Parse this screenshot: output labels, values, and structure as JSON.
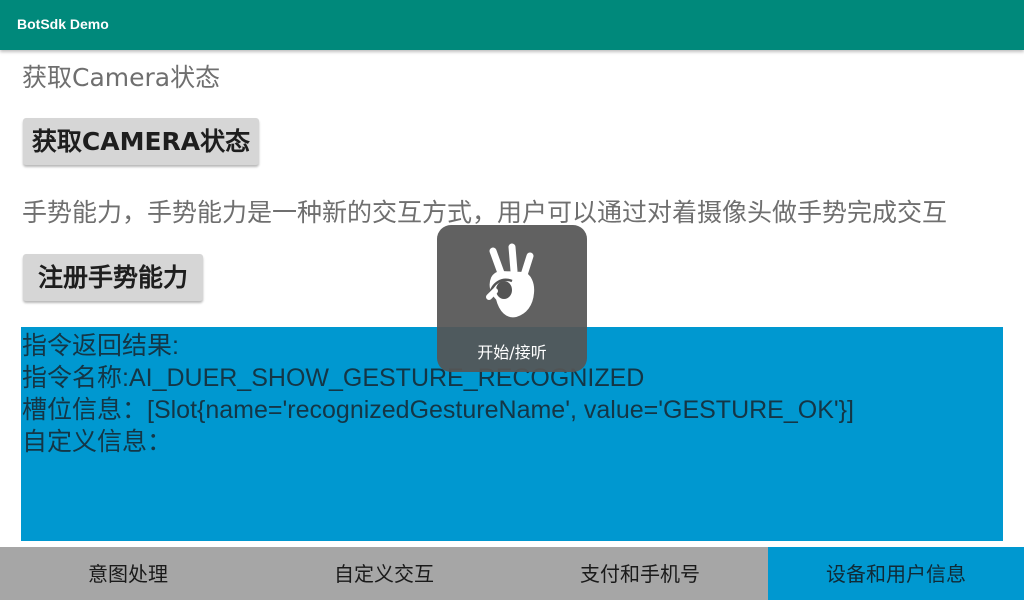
{
  "appbar": {
    "title": "BotSdk Demo"
  },
  "camera": {
    "status_label": "获取Camera状态",
    "button_label": "获取CAMERA状态"
  },
  "gesture": {
    "description": "手势能力，手势能力是一种新的交互方式，用户可以通过对着摄像头做手势完成交互",
    "register_button_label": "注册手势能力"
  },
  "result": {
    "lines": [
      "指令返回结果:",
      "指令名称:AI_DUER_SHOW_GESTURE_RECOGNIZED",
      "槽位信息：[Slot{name='recognizedGestureName', value='GESTURE_OK'}]",
      "自定义信息："
    ]
  },
  "toast": {
    "icon": "ok-hand-gesture-icon",
    "text": "开始/接听"
  },
  "bottom_nav": {
    "tabs": [
      {
        "label": "意图处理",
        "active": false
      },
      {
        "label": "自定义交互",
        "active": false
      },
      {
        "label": "支付和手机号",
        "active": false
      },
      {
        "label": "设备和用户信息",
        "active": true
      }
    ]
  },
  "colors": {
    "appbar": "#00897b",
    "result_panel": "#0098d0",
    "bottom_nav": "#a6a6a6",
    "active_tab": "#0098d0"
  }
}
